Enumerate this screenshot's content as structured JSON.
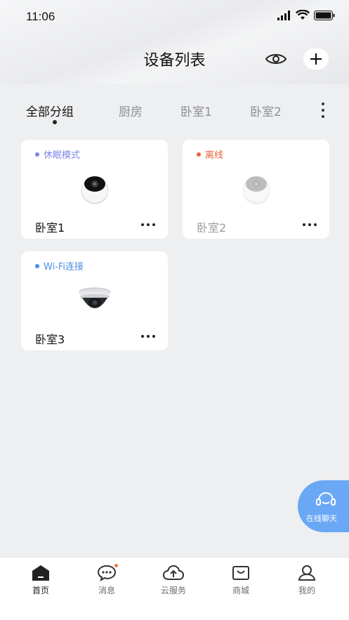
{
  "status_bar": {
    "time": "11:06"
  },
  "header": {
    "title": "设备列表"
  },
  "tabs": [
    {
      "label": "全部分组",
      "active": true
    },
    {
      "label": "厨房",
      "active": false
    },
    {
      "label": "卧室1",
      "active": false
    },
    {
      "label": "卧室2",
      "active": false
    }
  ],
  "devices": [
    {
      "status": "休眠模式",
      "status_color": "#7c84e8",
      "name": "卧室1",
      "online": true,
      "camera": "ptz-camera"
    },
    {
      "status": "离线",
      "status_color": "#e8643a",
      "name": "卧室2",
      "online": false,
      "camera": "ptz-camera"
    },
    {
      "status": "Wi-Fi连接",
      "status_color": "#4a90e2",
      "name": "卧室3",
      "online": true,
      "camera": "dome-camera"
    }
  ],
  "chat": {
    "label": "在线聊天"
  },
  "bottom_nav": [
    {
      "label": "首页",
      "icon": "home-icon",
      "active": true
    },
    {
      "label": "消息",
      "icon": "message-icon",
      "active": false
    },
    {
      "label": "云服务",
      "icon": "cloud-upload-icon",
      "active": false
    },
    {
      "label": "商城",
      "icon": "shop-icon",
      "active": false
    },
    {
      "label": "我的",
      "icon": "profile-icon",
      "active": false
    }
  ],
  "colors": {
    "accent": "#6aa8f5",
    "background": "#eeeff1"
  }
}
